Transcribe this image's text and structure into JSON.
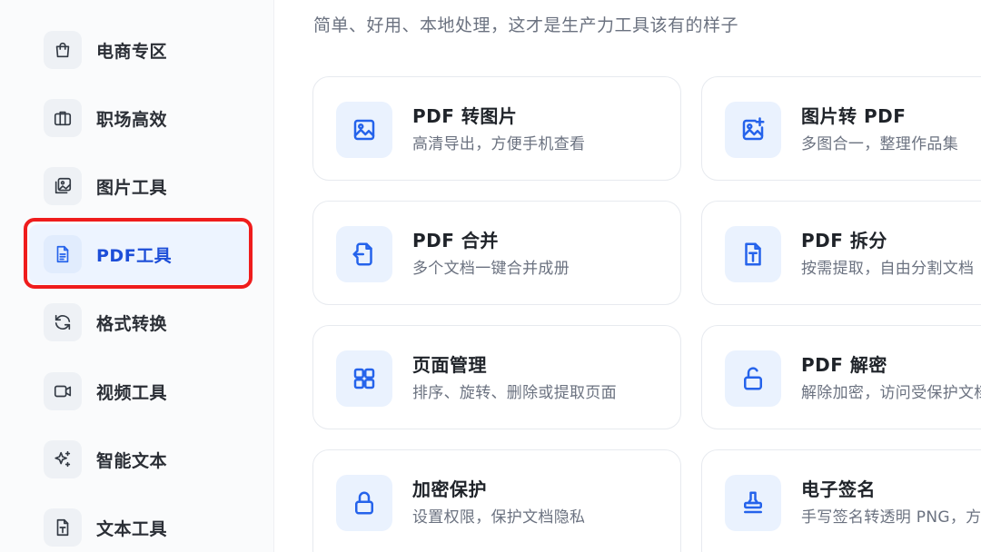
{
  "subtitle": "简单、好用、本地处理，这才是生产力工具该有的样子",
  "sidebar": {
    "items": [
      {
        "label": "电商专区",
        "icon": "shopping-bag-icon"
      },
      {
        "label": "职场高效",
        "icon": "briefcase-icon"
      },
      {
        "label": "图片工具",
        "icon": "images-icon"
      },
      {
        "label": "PDF工具",
        "icon": "document-icon",
        "active": true
      },
      {
        "label": "格式转换",
        "icon": "refresh-icon"
      },
      {
        "label": "视频工具",
        "icon": "video-camera-icon"
      },
      {
        "label": "智能文本",
        "icon": "sparkles-icon"
      },
      {
        "label": "文本工具",
        "icon": "text-file-icon"
      }
    ]
  },
  "tools": [
    {
      "title": "PDF 转图片",
      "desc": "高清导出，方便手机查看",
      "icon": "image-icon"
    },
    {
      "title": "图片转 PDF",
      "desc": "多图合一，整理作品集",
      "icon": "image-plus-icon"
    },
    {
      "title": "PDF 合并",
      "desc": "多个文档一键合并成册",
      "icon": "file-merge-icon"
    },
    {
      "title": "PDF 拆分",
      "desc": "按需提取，自由分割文档",
      "icon": "file-text-icon"
    },
    {
      "title": "页面管理",
      "desc": "排序、旋转、删除或提取页面",
      "icon": "grid-icon"
    },
    {
      "title": "PDF 解密",
      "desc": "解除加密，访问受保护文档",
      "icon": "unlock-icon"
    },
    {
      "title": "加密保护",
      "desc": "设置权限，保护文档隐私",
      "icon": "lock-icon"
    },
    {
      "title": "电子签名",
      "desc": "手写签名转透明 PNG，方便签章",
      "icon": "stamp-icon"
    }
  ],
  "colors": {
    "accent": "#2563eb",
    "highlight": "#ef1c1c"
  }
}
